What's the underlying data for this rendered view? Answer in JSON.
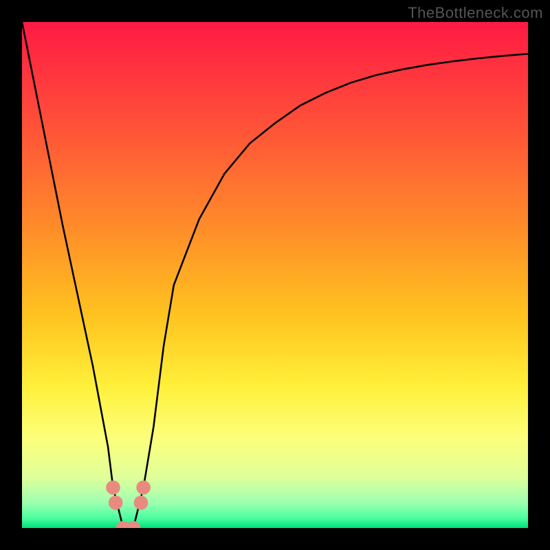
{
  "watermark": "TheBottleneck.com",
  "chart_data": {
    "type": "line",
    "title": "",
    "xlabel": "",
    "ylabel": "",
    "xlim": [
      0,
      100
    ],
    "ylim": [
      0,
      100
    ],
    "x": [
      0,
      2,
      5,
      8,
      11,
      14,
      17,
      18,
      20,
      22,
      24,
      26,
      28,
      30,
      35,
      40,
      45,
      50,
      55,
      60,
      65,
      70,
      75,
      80,
      85,
      90,
      95,
      100
    ],
    "values": [
      100,
      90,
      75,
      60,
      46,
      32,
      16,
      8,
      0,
      0,
      8,
      20,
      36,
      48,
      61,
      70,
      76,
      80,
      83.5,
      86,
      88,
      89.5,
      90.6,
      91.5,
      92.2,
      92.8,
      93.3,
      93.7
    ],
    "markers": {
      "x": [
        18,
        18.5,
        20,
        22,
        23.5,
        24
      ],
      "y": [
        8,
        5,
        0,
        0,
        5,
        8
      ]
    },
    "gradient_stops": [
      {
        "pct": 0,
        "color": "#ff1a44"
      },
      {
        "pct": 18,
        "color": "#ff4a3a"
      },
      {
        "pct": 40,
        "color": "#ff8a2a"
      },
      {
        "pct": 58,
        "color": "#ffc31f"
      },
      {
        "pct": 72,
        "color": "#fff03a"
      },
      {
        "pct": 82,
        "color": "#fdff7a"
      },
      {
        "pct": 90,
        "color": "#e0ff9a"
      },
      {
        "pct": 95,
        "color": "#9dffb0"
      },
      {
        "pct": 98,
        "color": "#4cffa0"
      },
      {
        "pct": 100,
        "color": "#00e07a"
      }
    ]
  }
}
